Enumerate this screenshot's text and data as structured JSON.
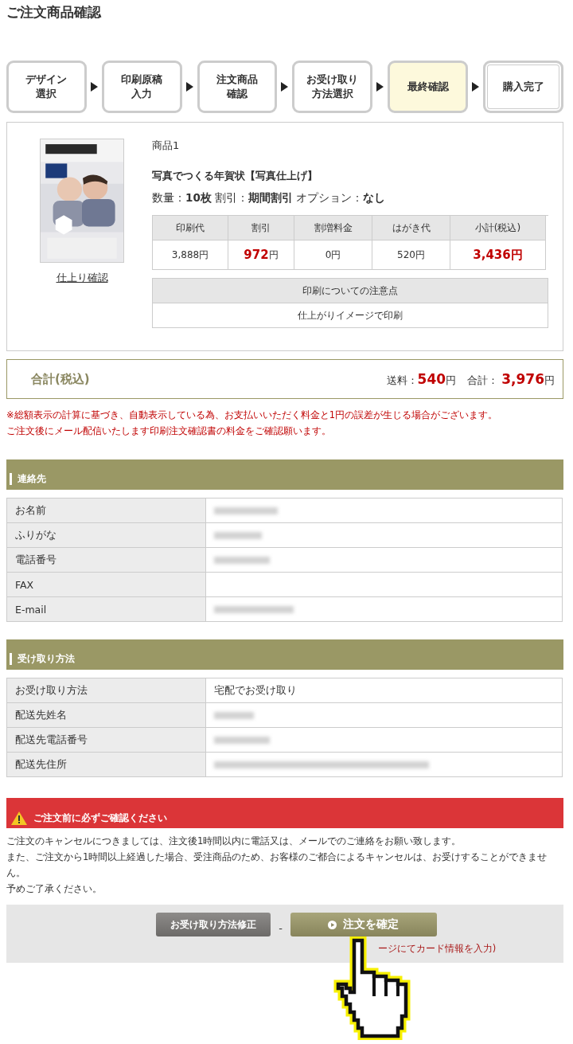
{
  "page_title": "ご注文商品確認",
  "steps": [
    {
      "label": [
        "デザイン",
        "選択"
      ],
      "selected": false,
      "kind": "step"
    },
    {
      "label": [
        "印刷原稿",
        "入力"
      ],
      "selected": false,
      "kind": "step"
    },
    {
      "label": [
        "注文商品",
        "確認"
      ],
      "selected": false,
      "kind": "step"
    },
    {
      "label": [
        "お受け取り",
        "方法選択"
      ],
      "selected": false,
      "kind": "step"
    },
    {
      "label": [
        "最終確認"
      ],
      "selected": true,
      "kind": "step"
    },
    {
      "label": [
        "購入完了"
      ],
      "selected": false,
      "kind": "goal"
    }
  ],
  "product": {
    "preview_link": "仕上り確認",
    "number": "商品1",
    "name": "写真でつくる年賀状【写真仕上げ】",
    "details": "数量：**10枚**  割引：**期間割引**  オプション：**なし**",
    "price_table": {
      "columns": [
        {
          "label": "印刷代",
          "value": "3,888円"
        },
        {
          "label": "割引",
          "value": "**972**円"
        },
        {
          "label": "割増料金",
          "value": "0円"
        },
        {
          "label": "はがき代",
          "value": "520円"
        },
        {
          "label": "小計(税込)",
          "value": "**3,436円**"
        }
      ]
    },
    "notes": {
      "heading": "印刷についての注意点",
      "value": "仕上がりイメージで印刷"
    }
  },
  "total": {
    "label": "合計(税込)",
    "shipping": "送料：**540**円",
    "sum": "合計： **3,976**円"
  },
  "disclaimer": [
    "※総額表示の計算に基づき、自動表示している為、お支払いいただく料金と1円の誤差が生じる場合がございます。",
    "ご注文後にメール配信いたします印刷注文確認書の料金をご確認願います。"
  ],
  "contact": {
    "heading": "連絡先",
    "rows": [
      {
        "label": "お名前",
        "kind": "redacted"
      },
      {
        "label": "ふりがな",
        "kind": "redacted"
      },
      {
        "label": "電話番号",
        "kind": "redacted"
      },
      {
        "label": "FAX",
        "kind": "empty"
      },
      {
        "label": "E-mail",
        "kind": "redacted"
      }
    ]
  },
  "delivery": {
    "heading": "受け取り方法",
    "rows": [
      {
        "label": "お受け取り方法",
        "kind": "text",
        "value": "宅配でお受け取り"
      },
      {
        "label": "配送先姓名",
        "kind": "redacted"
      },
      {
        "label": "配送先電話番号",
        "kind": "redacted"
      },
      {
        "label": "配送先住所",
        "kind": "redacted"
      }
    ]
  },
  "warning": {
    "heading": "ご注文前に必ずご確認ください",
    "paragraphs": [
      "ご注文のキャンセルにつきましては、注文後1時間以内に電話又は、メールでのご連絡をお願い致します。",
      "また、ご注文から1時間以上経過した場合、受注商品のため、お客様のご都合によるキャンセルは、お受けすることができません。",
      "予めご了承ください。"
    ]
  },
  "actions": {
    "back_button": "お受け取り方法修正",
    "separator": "-",
    "confirm_button": "注文を確定",
    "note": "ージにてカード情報を入力)"
  }
}
